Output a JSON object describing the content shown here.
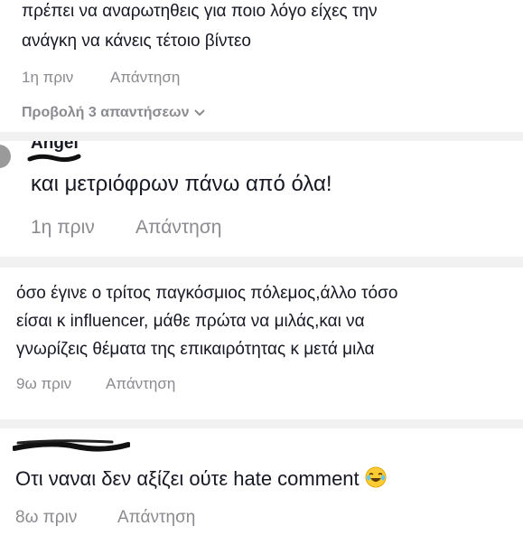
{
  "comments": [
    {
      "lines": [
        "πρέπει να αναρωτηθεις για ποιο λόγο είχες την",
        "ανάγκη να κάνεις τέτοιο βίντεο"
      ],
      "time": "1η πριν",
      "reply_label": "Απάντηση",
      "view_replies_label": "Προβολή 3 απαντήσεων"
    },
    {
      "username_partial": "Angel",
      "lines": [
        "και μετριόφρων πάνω από όλα!"
      ],
      "time": "1η πριν",
      "reply_label": "Απάντηση"
    },
    {
      "lines": [
        "όσο έγινε ο τρίτος παγκόσμιος πόλεμος,άλλο τόσο",
        "είσαι κ influencer, μάθε πρώτα να μιλάς,και να",
        "γνωρίζεις θέματα της επικαιρότητας κ μετά μιλα"
      ],
      "time": "9ω πριν",
      "reply_label": "Απάντηση"
    },
    {
      "lines": [
        "Οτι ναναι δεν αξίζει ούτε hate comment"
      ],
      "emoji": "face-with-tears-of-joy-icon",
      "time": "8ω πριν",
      "reply_label": "Απάντηση"
    }
  ],
  "colors": {
    "text": "#161823",
    "meta": "#8a8b91",
    "gap": "#f1f1f2",
    "emoji_face": "#ffcc33"
  }
}
